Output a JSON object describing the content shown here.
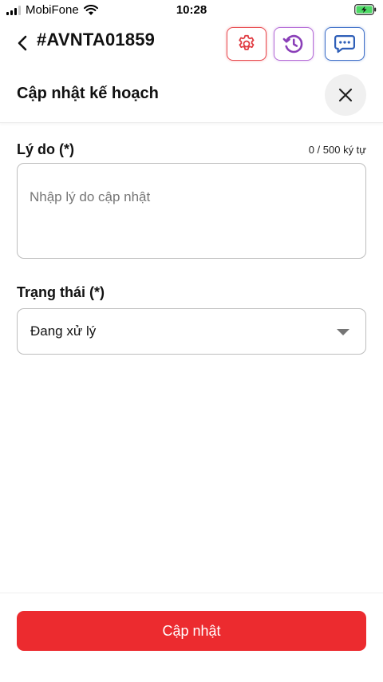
{
  "status_bar": {
    "carrier": "MobiFone",
    "time": "10:28"
  },
  "header": {
    "order_id": "#AVNTA01859",
    "icons": [
      "back-chevron-icon",
      "settings-gear-icon",
      "history-clock-icon",
      "chat-bubble-icon"
    ],
    "colors": {
      "settings": "#e84a4f",
      "history": "#b46bd6",
      "chat": "#4070c8"
    }
  },
  "sheet": {
    "title": "Cập nhật kế hoạch",
    "close_icon": "close-x-icon"
  },
  "form": {
    "reason": {
      "label": "Lý do (*)",
      "counter": "0 / 500 ký tự",
      "value": "",
      "placeholder": "Nhập lý do cập nhật"
    },
    "status": {
      "label": "Trạng thái (*)",
      "selected": "Đang xử lý"
    }
  },
  "footer": {
    "submit_label": "Cập nhật",
    "accent_color": "#ec2b2f"
  }
}
